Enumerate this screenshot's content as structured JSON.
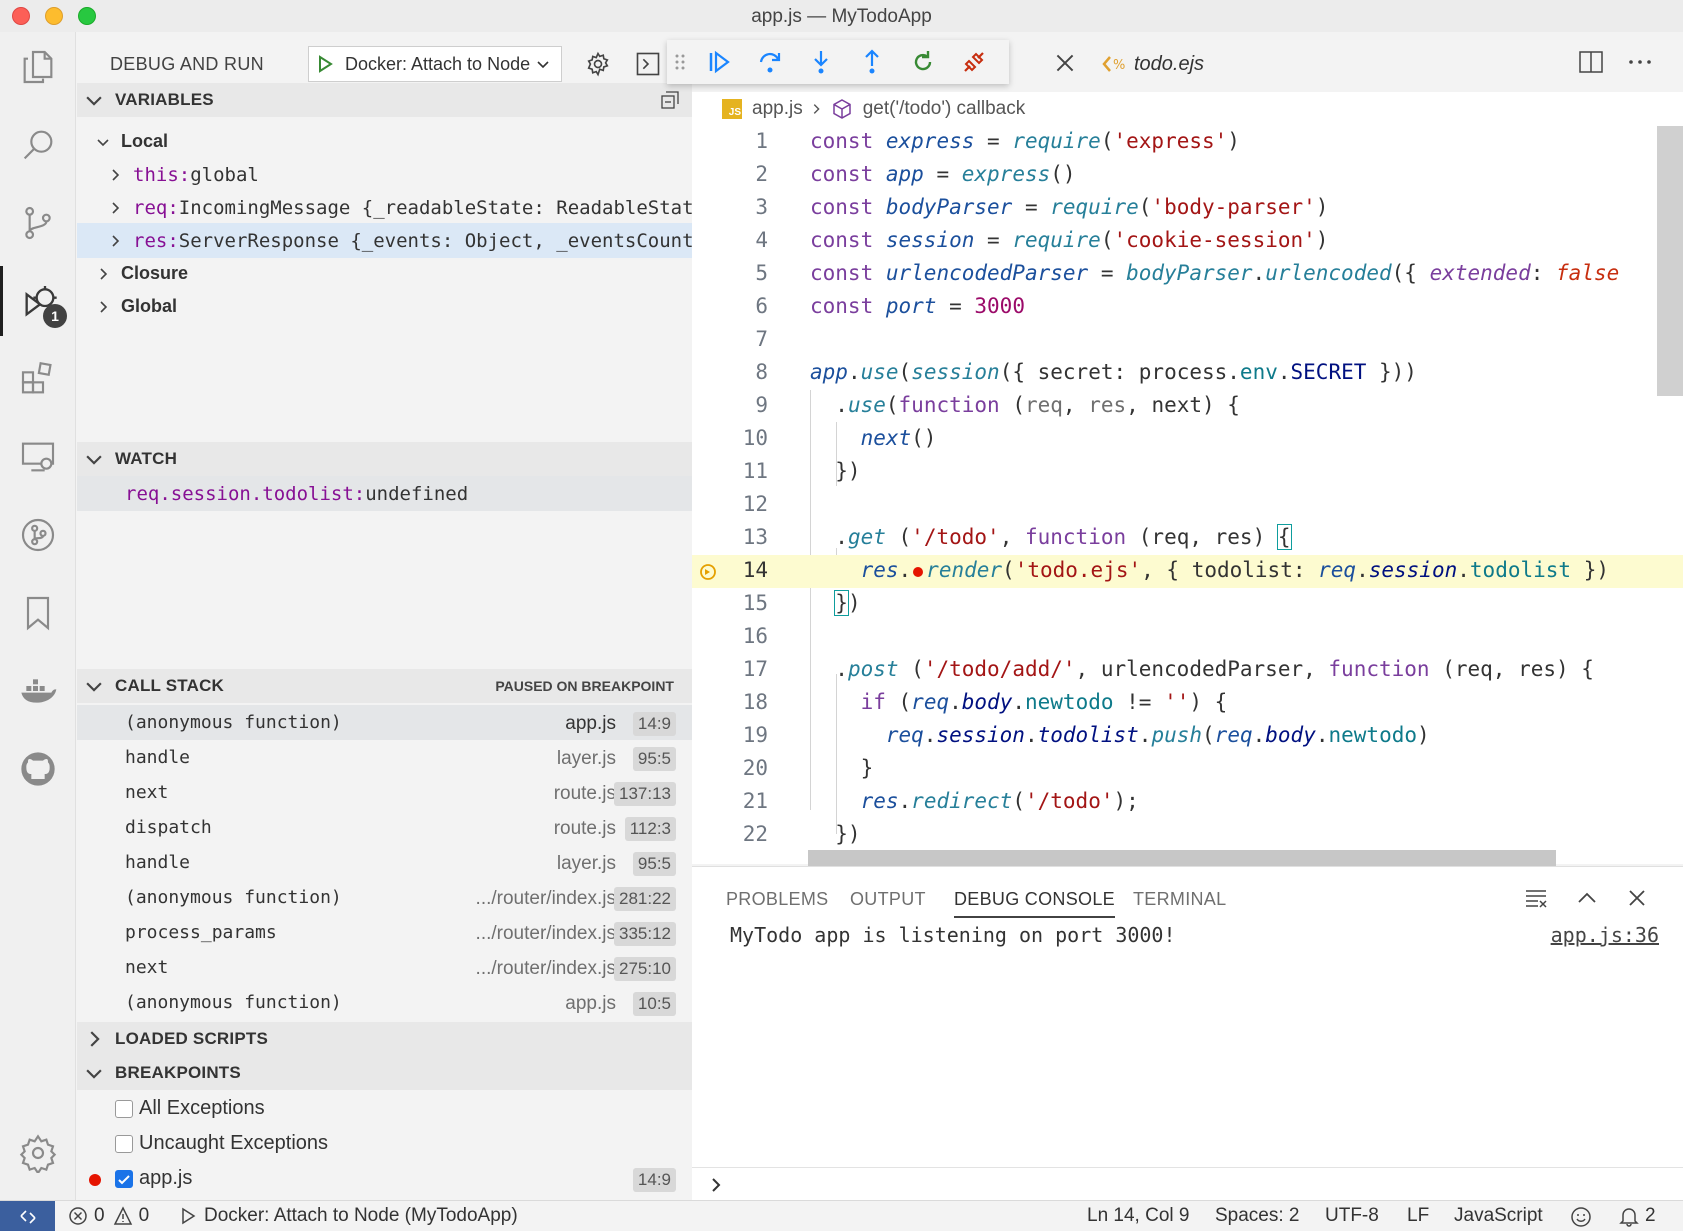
{
  "window": {
    "title": "app.js — MyTodoApp"
  },
  "activity": {
    "debug_badge": "1"
  },
  "sidebar": {
    "title": "DEBUG AND RUN",
    "config": "Docker: Attach to Node",
    "variables": {
      "header": "VARIABLES",
      "local_label": "Local",
      "items": [
        {
          "name": "this:",
          "value": " global"
        },
        {
          "name": "req:",
          "value": " IncomingMessage {_readableState: ReadableState…"
        },
        {
          "name": "res:",
          "value": " ServerResponse {_events: Object, _eventsCount:…"
        }
      ],
      "closure_label": "Closure",
      "global_label": "Global"
    },
    "watch": {
      "header": "WATCH",
      "expr": "req.session.todolist:",
      "value": " undefined"
    },
    "callstack": {
      "header": "CALL STACK",
      "status": "PAUSED ON BREAKPOINT",
      "frames": [
        {
          "fn": "(anonymous function)",
          "file": "app.js",
          "pos": "14:9"
        },
        {
          "fn": "handle",
          "file": "layer.js",
          "pos": "95:5"
        },
        {
          "fn": "next",
          "file": "route.js",
          "pos": "137:13"
        },
        {
          "fn": "dispatch",
          "file": "route.js",
          "pos": "112:3"
        },
        {
          "fn": "handle",
          "file": "layer.js",
          "pos": "95:5"
        },
        {
          "fn": "(anonymous function)",
          "file": ".../router/index.js",
          "pos": "281:22"
        },
        {
          "fn": "process_params",
          "file": ".../router/index.js",
          "pos": "335:12"
        },
        {
          "fn": "next",
          "file": ".../router/index.js",
          "pos": "275:10"
        },
        {
          "fn": "(anonymous function)",
          "file": "app.js",
          "pos": "10:5"
        }
      ]
    },
    "loaded_scripts": {
      "header": "LOADED SCRIPTS"
    },
    "breakpoints": {
      "header": "BREAKPOINTS",
      "items": [
        {
          "label": "All Exceptions",
          "checked": false,
          "pos": ""
        },
        {
          "label": "Uncaught Exceptions",
          "checked": false,
          "pos": ""
        },
        {
          "label": "app.js",
          "checked": true,
          "pos": "14:9"
        }
      ]
    }
  },
  "editor": {
    "tab_label": "todo.ejs",
    "breadcrumb": {
      "file": "app.js",
      "symbol": "get('/todo') callback",
      "file_icon_text": "JS"
    },
    "line_numbers": [
      "1",
      "2",
      "3",
      "4",
      "5",
      "6",
      "7",
      "8",
      "9",
      "10",
      "11",
      "12",
      "13",
      "14",
      "15",
      "16",
      "17",
      "18",
      "19",
      "20",
      "21",
      "22"
    ],
    "current_line": "14"
  },
  "panel": {
    "tabs": [
      "PROBLEMS",
      "OUTPUT",
      "DEBUG CONSOLE",
      "TERMINAL"
    ],
    "active_tab": "DEBUG CONSOLE",
    "console_output": "MyTodo app is listening on port 3000!",
    "console_source": "app.js:36"
  },
  "statusbar": {
    "errors": "0",
    "warnings": "0",
    "debug_config": "Docker: Attach to Node (MyTodoApp)",
    "cursor": "Ln 14, Col 9",
    "spaces": "Spaces: 2",
    "encoding": "UTF-8",
    "eol": "LF",
    "language": "JavaScript",
    "notifications": "2"
  },
  "colors": {
    "breakpoint_red": "#e51400",
    "current_line_bg": "#fdfbd0",
    "selection_bg": "#dbe8f6"
  }
}
